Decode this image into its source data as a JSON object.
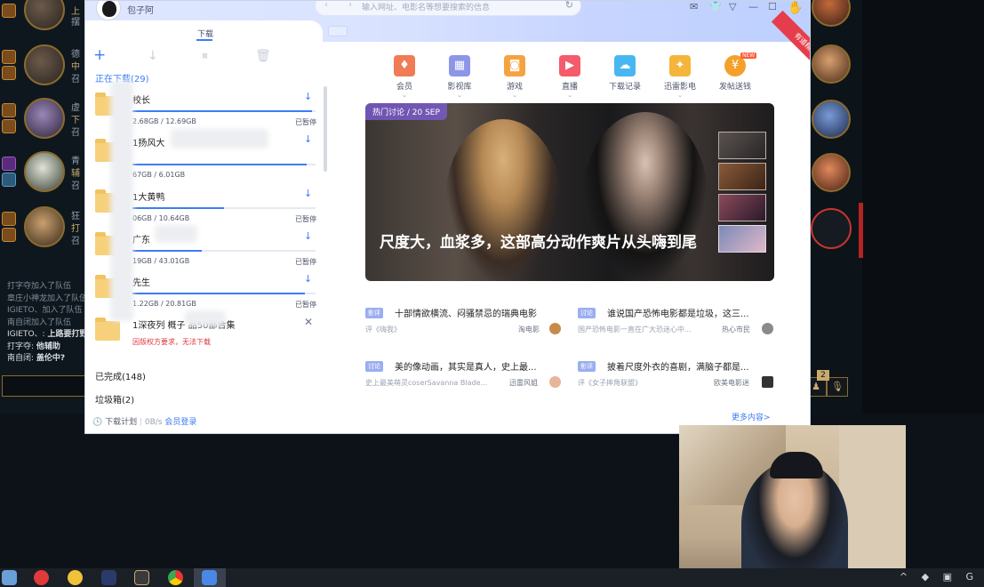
{
  "game": {
    "left_names": [
      "上",
      "中",
      "下",
      "辅",
      "打"
    ],
    "left_subs": [
      "摆",
      "召",
      "召",
      "召",
      "召"
    ],
    "left_players": [
      "",
      "德",
      "虚",
      "青",
      "狂"
    ],
    "chat_lines": [
      {
        "prefix": "打字夺加入了队伍",
        "bold": ""
      },
      {
        "prefix": "章庄小神龙加入了队伍",
        "bold": ""
      },
      {
        "prefix": "IGIETO、加入了队伍",
        "bold": ""
      },
      {
        "prefix": "南自闭加入了队伍",
        "bold": ""
      },
      {
        "prefix": "IGIETO、: ",
        "bold": "上路要打野"
      },
      {
        "prefix": "打字夺: ",
        "bold": "他辅助"
      },
      {
        "prefix": "南自闭: ",
        "bold": "盖伦中?"
      }
    ],
    "badge_count": "2"
  },
  "window": {
    "username": "包子阿",
    "url_placeholder": "输入网址、电影名等想要搜索的信息",
    "tab_download": "下载",
    "corner_ribbon": "有道精选"
  },
  "downloads": {
    "section_downloading": "正在下载(29)",
    "items": [
      {
        "name": "校长",
        "size": "2.68GB / 12.69GB",
        "status": "已暂停",
        "progress": 0.98,
        "folder_code": "BT"
      },
      {
        "name": "1扬风大",
        "size": "67GB / 6.01GB",
        "status": "",
        "progress": 0.95,
        "folder_code": "BT"
      },
      {
        "name": "1大黄鸭",
        "size": "06GB / 10.64GB",
        "status": "已暂停",
        "progress": 0.5,
        "folder_code": "BT"
      },
      {
        "name": "广东",
        "size": "19GB / 43.01GB",
        "status": "已暂停",
        "progress": 0.38,
        "folder_code": "BT"
      },
      {
        "name": "先生",
        "size": "1.22GB / 20.81GB",
        "status": "已暂停",
        "progress": 0.94,
        "folder_code": "BT"
      },
      {
        "name": "1深夜列 概子      品50部合集",
        "size": "",
        "status": "",
        "progress": 0,
        "warn": "因版权方要求，无法下载",
        "folder_code": "BT"
      }
    ],
    "section_done": "已完成(148)",
    "section_trash": "垃圾箱(2)",
    "footer": {
      "plan": "下载计划",
      "speed": "0B/s",
      "login": "会员登录"
    }
  },
  "nav": [
    {
      "label": "会员",
      "icon": "heart-gem-icon",
      "color": "#f07b55"
    },
    {
      "label": "影视库",
      "icon": "film-icon",
      "color": "#8c96e8"
    },
    {
      "label": "游戏",
      "icon": "gamepad-icon",
      "color": "#f4a340"
    },
    {
      "label": "直播",
      "icon": "tv-icon",
      "color": "#f45b6b"
    },
    {
      "label": "下载记录",
      "icon": "cloud-icon",
      "color": "#48b7f1"
    },
    {
      "label": "迅雷影电",
      "icon": "bird-icon",
      "color": "#f4b53a"
    },
    {
      "label": "发帖送钱",
      "icon": "coin-icon",
      "color": "#f4a02a",
      "new_tag": "NEW"
    }
  ],
  "banner": {
    "tag": "热门讨论 / 20 SEP",
    "title": "尺度大，血浆多，这部高分动作爽片从头嗨到尾"
  },
  "news": [
    {
      "tag": "影评",
      "title": "十部情欲横流、闷骚禁忌的瑞典电影",
      "source": "评《嗨我》",
      "author": "淘电影"
    },
    {
      "tag": "讨论",
      "title": "谁说国产恐怖电影都是垃圾，这三...",
      "source": "国产恐怖电影一直在广大恐迷心中...",
      "author": "热心市民"
    },
    {
      "tag": "讨论",
      "title": "美的像动画，其实是真人，史上最...",
      "source": "史上最美萌灵coserSavanna Blade...",
      "author": "迅雷风姐"
    },
    {
      "tag": "影评",
      "title": "披着尺度外衣的喜剧，满脑子都是...",
      "source": "评《女子摔角联盟》",
      "author": "欧美电影迷"
    }
  ],
  "more_label": "更多内容>",
  "colors": {
    "accent": "#3d7cf5",
    "warn": "#e0373f",
    "folder": "#f6d07a"
  }
}
